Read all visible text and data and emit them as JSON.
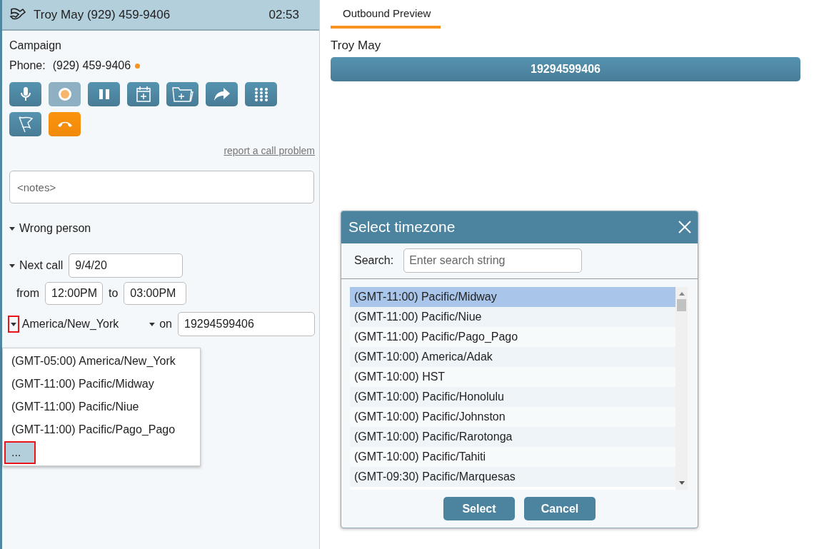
{
  "call_header": {
    "title": "Troy May (929) 459-9406",
    "timer": "02:53"
  },
  "campaign": "Campaign",
  "phone": {
    "label": "Phone:",
    "value": "(929) 459-9406"
  },
  "controls": [
    {
      "kind": "mic",
      "disabled": false
    },
    {
      "kind": "record",
      "disabled": true
    },
    {
      "kind": "pause",
      "disabled": false
    },
    {
      "kind": "calendar",
      "disabled": false
    },
    {
      "kind": "folder",
      "disabled": false
    },
    {
      "kind": "forward",
      "disabled": false
    },
    {
      "kind": "keypad",
      "disabled": false
    },
    {
      "kind": "flag",
      "disabled": false
    },
    {
      "kind": "hangup",
      "disabled": false
    }
  ],
  "report_link": "report a call problem",
  "notes": {
    "placeholder": "<notes>"
  },
  "disposition": {
    "label": "Wrong person",
    "expanded": true
  },
  "next_call": {
    "label": "Next call",
    "date": "9/4/20",
    "from_label": "from",
    "from": "12:00PM",
    "to_label": "to",
    "to": "03:00PM"
  },
  "timezone": {
    "value": "America/New_York",
    "highlighted": true,
    "on_label": "on",
    "number": "19294599406"
  },
  "timezone_menu": [
    {
      "label": "(GMT-05:00) America/New_York",
      "selected": false,
      "highlighted": false
    },
    {
      "label": "(GMT-11:00) Pacific/Midway",
      "selected": false,
      "highlighted": false
    },
    {
      "label": "(GMT-11:00) Pacific/Niue",
      "selected": false,
      "highlighted": false
    },
    {
      "label": "(GMT-11:00) Pacific/Pago_Pago",
      "selected": false,
      "highlighted": false
    },
    {
      "label": "...",
      "selected": true,
      "highlighted": true
    }
  ],
  "tabs": [
    {
      "label": "Outbound Preview",
      "selected": true
    }
  ],
  "preview": {
    "name": "Troy May",
    "number": "19294599406"
  },
  "dialog": {
    "title": "Select timezone",
    "search_label": "Search:",
    "search_placeholder": "Enter search string",
    "items": [
      {
        "label": "(GMT-11:00) Pacific/Midway",
        "selected": true
      },
      {
        "label": "(GMT-11:00) Pacific/Niue",
        "selected": false
      },
      {
        "label": "(GMT-11:00) Pacific/Pago_Pago",
        "selected": false
      },
      {
        "label": "(GMT-10:00) America/Adak",
        "selected": false
      },
      {
        "label": "(GMT-10:00) HST",
        "selected": false
      },
      {
        "label": "(GMT-10:00) Pacific/Honolulu",
        "selected": false
      },
      {
        "label": "(GMT-10:00) Pacific/Johnston",
        "selected": false
      },
      {
        "label": "(GMT-10:00) Pacific/Rarotonga",
        "selected": false
      },
      {
        "label": "(GMT-10:00) Pacific/Tahiti",
        "selected": false
      },
      {
        "label": "(GMT-09:30) Pacific/Marquesas",
        "selected": false
      }
    ],
    "buttons": [
      "Select",
      "Cancel"
    ]
  }
}
